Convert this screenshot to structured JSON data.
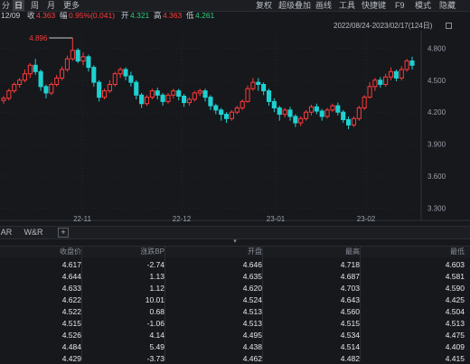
{
  "toolbar": {
    "left_items": [
      "分",
      "日",
      "周",
      "月",
      "更多"
    ],
    "selected": "日",
    "right_items": [
      "复权",
      "超级叠加",
      "画线",
      "工具",
      "快捷键",
      "F9",
      "模式",
      "隐藏"
    ],
    "left_partial": "日"
  },
  "status": {
    "date": "12/09",
    "close_label": "收",
    "close_value": "4.363",
    "change_label": "幅",
    "change_value": "0.95%(0.041)",
    "open_label": "开",
    "open_value": "4.321",
    "high_label": "高",
    "high_value": "4.363",
    "low_label": "低",
    "low_value": "4.261"
  },
  "range_label": "2022/08/24-2023/02/17(124日)",
  "chart_data": {
    "type": "candlestick",
    "y_ticks": [
      "4.800",
      "4.500",
      "4.200",
      "3.900",
      "3.600",
      "3.300"
    ],
    "ylim": [
      3.27,
      4.93
    ],
    "x_ticks": [
      "22-11",
      "22-12",
      "23-01",
      "23-02"
    ],
    "peak_annotation": "4.896",
    "colors": {
      "up": "#ff3b3b",
      "down": "#1fd1d1"
    },
    "candles": [
      [
        4.31,
        4.33,
        4.35,
        4.28
      ],
      [
        4.33,
        4.4,
        4.42,
        4.31
      ],
      [
        4.4,
        4.46,
        4.48,
        4.38
      ],
      [
        4.46,
        4.5,
        4.52,
        4.43
      ],
      [
        4.5,
        4.56,
        4.6,
        4.48
      ],
      [
        4.56,
        4.64,
        4.66,
        4.52
      ],
      [
        4.64,
        4.58,
        4.7,
        4.55
      ],
      [
        4.58,
        4.44,
        4.6,
        4.4
      ],
      [
        4.44,
        4.38,
        4.46,
        4.33
      ],
      [
        4.38,
        4.46,
        4.48,
        4.36
      ],
      [
        4.46,
        4.52,
        4.55,
        4.44
      ],
      [
        4.52,
        4.6,
        4.63,
        4.5
      ],
      [
        4.6,
        4.7,
        4.73,
        4.58
      ],
      [
        4.7,
        4.78,
        4.896,
        4.68
      ],
      [
        4.78,
        4.68,
        4.8,
        4.66
      ],
      [
        4.68,
        4.72,
        4.76,
        4.64
      ],
      [
        4.72,
        4.62,
        4.74,
        4.58
      ],
      [
        4.62,
        4.48,
        4.64,
        4.44
      ],
      [
        4.48,
        4.34,
        4.5,
        4.3
      ],
      [
        4.34,
        4.4,
        4.42,
        4.32
      ],
      [
        4.4,
        4.46,
        4.5,
        4.38
      ],
      [
        4.46,
        4.56,
        4.58,
        4.44
      ],
      [
        4.56,
        4.6,
        4.62,
        4.52
      ],
      [
        4.6,
        4.54,
        4.62,
        4.5
      ],
      [
        4.54,
        4.48,
        4.58,
        4.44
      ],
      [
        4.48,
        4.36,
        4.5,
        4.32
      ],
      [
        4.36,
        4.28,
        4.38,
        4.24
      ],
      [
        4.28,
        4.34,
        4.36,
        4.26
      ],
      [
        4.34,
        4.4,
        4.42,
        4.32
      ],
      [
        4.4,
        4.36,
        4.43,
        4.32
      ],
      [
        4.36,
        4.3,
        4.38,
        4.26
      ],
      [
        4.3,
        4.36,
        4.38,
        4.28
      ],
      [
        4.36,
        4.4,
        4.42,
        4.33
      ],
      [
        4.4,
        4.35,
        4.42,
        4.31
      ],
      [
        4.35,
        4.29,
        4.37,
        4.25
      ],
      [
        4.29,
        4.32,
        4.34,
        4.26
      ],
      [
        4.32,
        4.38,
        4.4,
        4.3
      ],
      [
        4.38,
        4.4,
        4.42,
        4.35
      ],
      [
        4.4,
        4.34,
        4.42,
        4.3
      ],
      [
        4.34,
        4.26,
        4.36,
        4.22
      ],
      [
        4.26,
        4.22,
        4.28,
        4.18
      ],
      [
        4.22,
        4.18,
        4.24,
        4.12
      ],
      [
        4.18,
        4.14,
        4.2,
        4.1
      ],
      [
        4.14,
        4.2,
        4.22,
        4.12
      ],
      [
        4.2,
        4.24,
        4.26,
        4.18
      ],
      [
        4.24,
        4.3,
        4.32,
        4.22
      ],
      [
        4.3,
        4.42,
        4.45,
        4.29
      ],
      [
        4.42,
        4.48,
        4.52,
        4.4
      ],
      [
        4.48,
        4.46,
        4.52,
        4.4
      ],
      [
        4.46,
        4.4,
        4.48,
        4.36
      ],
      [
        4.4,
        4.3,
        4.42,
        4.26
      ],
      [
        4.3,
        4.24,
        4.33,
        4.2
      ],
      [
        4.24,
        4.18,
        4.26,
        4.12
      ],
      [
        4.18,
        4.22,
        4.24,
        4.15
      ],
      [
        4.22,
        4.16,
        4.25,
        4.12
      ],
      [
        4.16,
        4.1,
        4.18,
        4.06
      ],
      [
        4.1,
        4.14,
        4.16,
        4.07
      ],
      [
        4.14,
        4.2,
        4.22,
        4.12
      ],
      [
        4.2,
        4.25,
        4.27,
        4.17
      ],
      [
        4.25,
        4.21,
        4.28,
        4.18
      ],
      [
        4.21,
        4.16,
        4.23,
        4.12
      ],
      [
        4.16,
        4.22,
        4.24,
        4.14
      ],
      [
        4.22,
        4.26,
        4.28,
        4.2
      ],
      [
        4.26,
        4.2,
        4.29,
        4.17
      ],
      [
        4.2,
        4.13,
        4.22,
        4.1
      ],
      [
        4.13,
        4.08,
        4.16,
        4.04
      ],
      [
        4.08,
        4.14,
        4.16,
        4.06
      ],
      [
        4.14,
        4.24,
        4.26,
        4.12
      ],
      [
        4.24,
        4.34,
        4.36,
        4.22
      ],
      [
        4.34,
        4.44,
        4.48,
        4.33
      ],
      [
        4.44,
        4.5,
        4.52,
        4.4
      ],
      [
        4.5,
        4.46,
        4.53,
        4.43
      ],
      [
        4.46,
        4.53,
        4.56,
        4.44
      ],
      [
        4.53,
        4.58,
        4.62,
        4.5
      ],
      [
        4.58,
        4.52,
        4.6,
        4.49
      ],
      [
        4.52,
        4.6,
        4.63,
        4.5
      ],
      [
        4.6,
        4.68,
        4.7,
        4.58
      ],
      [
        4.68,
        4.64,
        4.72,
        4.6
      ]
    ]
  },
  "tabs": [
    "AR",
    "W&R"
  ],
  "add_tab_label": "+",
  "collapse_icon": "▾",
  "table": {
    "headers": [
      "收盘价",
      "涨跌BP",
      "开盘",
      "最高",
      "最低"
    ],
    "rows": [
      [
        "4.617",
        "-2.74",
        "4.646",
        "4.718",
        "4.603"
      ],
      [
        "4.644",
        "1.13",
        "4.635",
        "4.687",
        "4.581"
      ],
      [
        "4.633",
        "1.12",
        "4.620",
        "4.703",
        "4.590"
      ],
      [
        "4.622",
        "10.01",
        "4.524",
        "4.643",
        "4.425"
      ],
      [
        "4.522",
        "0.68",
        "4.513",
        "4.560",
        "4.504"
      ],
      [
        "4.515",
        "-1.06",
        "4.513",
        "4.515",
        "4.513"
      ],
      [
        "4.526",
        "4.14",
        "4.495",
        "4.534",
        "4.475"
      ],
      [
        "4.484",
        "5.49",
        "4.438",
        "4.514",
        "4.409"
      ],
      [
        "4.429",
        "-3.73",
        "4.462",
        "4.482",
        "4.415"
      ]
    ]
  }
}
